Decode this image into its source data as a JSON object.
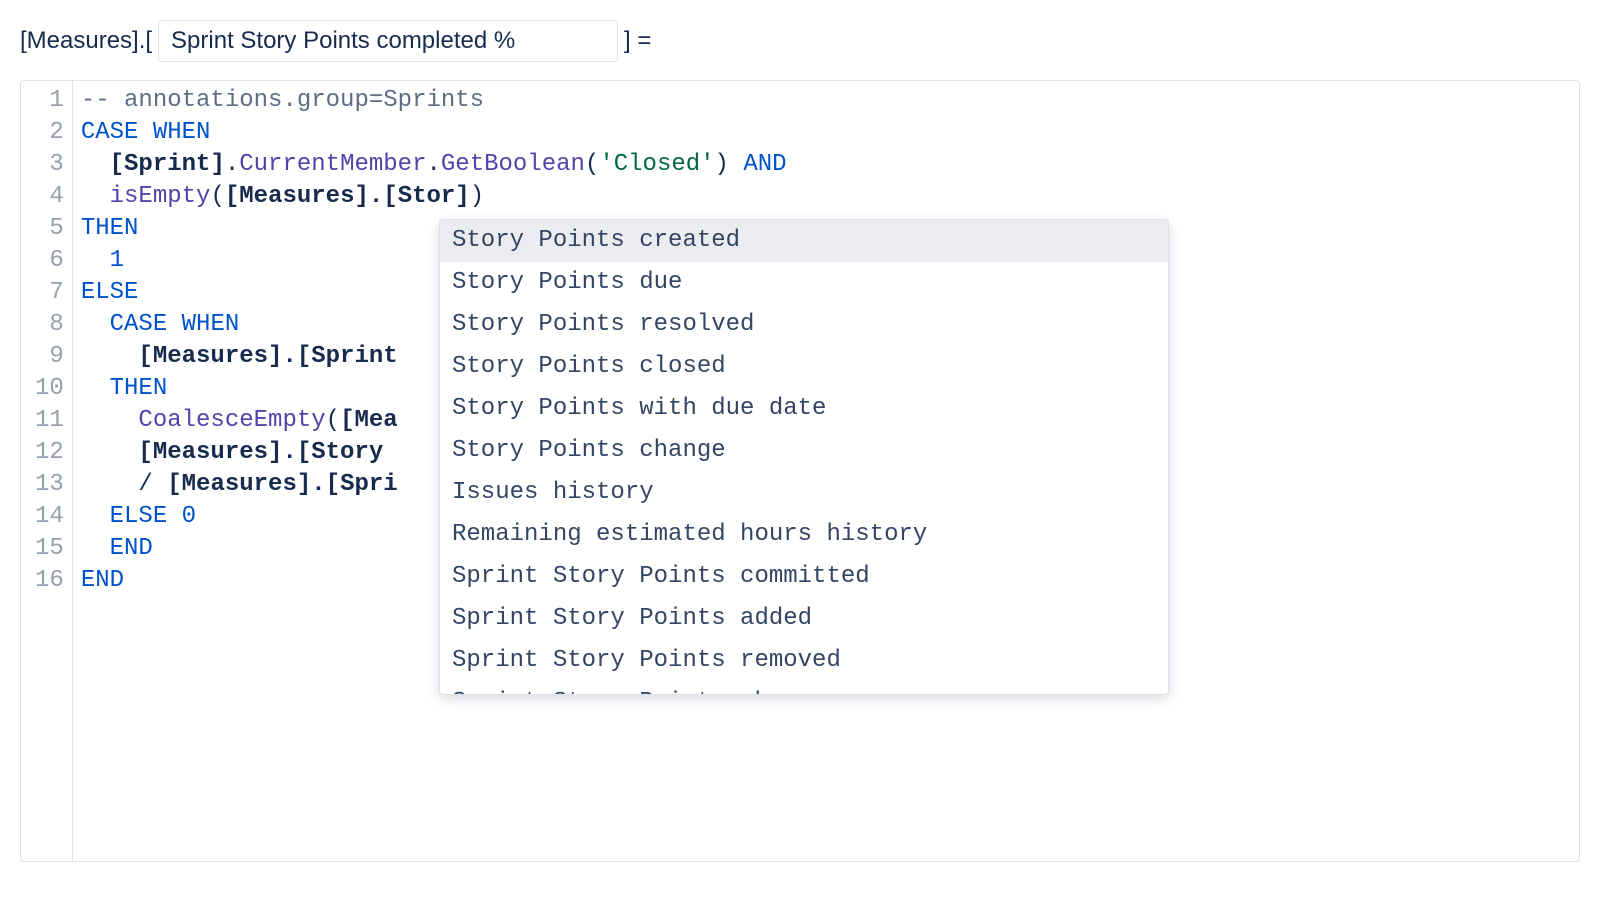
{
  "header": {
    "prefix": "[Measures].[",
    "name_value": "Sprint Story Points completed %",
    "suffix": "] ="
  },
  "code": {
    "lines": [
      {
        "n": 1,
        "tokens": [
          {
            "cls": "tok-comment",
            "t": "-- annotations.group=Sprints"
          }
        ]
      },
      {
        "n": 2,
        "tokens": [
          {
            "cls": "tok-kw",
            "t": "CASE WHEN"
          }
        ]
      },
      {
        "n": 3,
        "tokens": [
          {
            "cls": "",
            "t": "  "
          },
          {
            "cls": "tok-bold",
            "t": "[Sprint]"
          },
          {
            "cls": "",
            "t": "."
          },
          {
            "cls": "tok-purple",
            "t": "CurrentMember"
          },
          {
            "cls": "",
            "t": "."
          },
          {
            "cls": "tok-purple",
            "t": "GetBoolean"
          },
          {
            "cls": "",
            "t": "("
          },
          {
            "cls": "tok-str",
            "t": "'Closed'"
          },
          {
            "cls": "",
            "t": ") "
          },
          {
            "cls": "tok-kw",
            "t": "AND"
          }
        ]
      },
      {
        "n": 4,
        "tokens": [
          {
            "cls": "",
            "t": "  "
          },
          {
            "cls": "tok-purple",
            "t": "isEmpty"
          },
          {
            "cls": "",
            "t": "("
          },
          {
            "cls": "tok-bold",
            "t": "[Measures].[Stor]"
          },
          {
            "cls": "",
            "t": ")"
          }
        ]
      },
      {
        "n": 5,
        "tokens": [
          {
            "cls": "tok-kw",
            "t": "THEN"
          }
        ]
      },
      {
        "n": 6,
        "tokens": [
          {
            "cls": "",
            "t": "  "
          },
          {
            "cls": "tok-num",
            "t": "1"
          }
        ]
      },
      {
        "n": 7,
        "tokens": [
          {
            "cls": "tok-kw",
            "t": "ELSE"
          }
        ]
      },
      {
        "n": 8,
        "tokens": [
          {
            "cls": "",
            "t": "  "
          },
          {
            "cls": "tok-kw",
            "t": "CASE WHEN"
          }
        ]
      },
      {
        "n": 9,
        "tokens": [
          {
            "cls": "",
            "t": "    "
          },
          {
            "cls": "tok-bold",
            "t": "[Measures].[Sprint"
          }
        ]
      },
      {
        "n": 10,
        "tokens": [
          {
            "cls": "",
            "t": "  "
          },
          {
            "cls": "tok-kw",
            "t": "THEN"
          }
        ]
      },
      {
        "n": 11,
        "tokens": [
          {
            "cls": "",
            "t": "    "
          },
          {
            "cls": "tok-purple",
            "t": "CoalesceEmpty"
          },
          {
            "cls": "",
            "t": "("
          },
          {
            "cls": "tok-bold",
            "t": "[Mea"
          }
        ]
      },
      {
        "n": 12,
        "tokens": [
          {
            "cls": "",
            "t": "    "
          },
          {
            "cls": "tok-bold",
            "t": "[Measures].[Story "
          }
        ]
      },
      {
        "n": 13,
        "tokens": [
          {
            "cls": "",
            "t": "    / "
          },
          {
            "cls": "tok-bold",
            "t": "[Measures].[Spri"
          }
        ]
      },
      {
        "n": 14,
        "tokens": [
          {
            "cls": "",
            "t": "  "
          },
          {
            "cls": "tok-kw",
            "t": "ELSE"
          },
          {
            "cls": "",
            "t": " "
          },
          {
            "cls": "tok-num",
            "t": "0"
          }
        ]
      },
      {
        "n": 15,
        "tokens": [
          {
            "cls": "",
            "t": "  "
          },
          {
            "cls": "tok-kw",
            "t": "END"
          }
        ]
      },
      {
        "n": 16,
        "tokens": [
          {
            "cls": "tok-kw",
            "t": "END"
          }
        ]
      }
    ]
  },
  "autocomplete": {
    "selected_index": 0,
    "items": [
      "Story Points created",
      "Story Points due",
      "Story Points resolved",
      "Story Points closed",
      "Story Points with due date",
      "Story Points change",
      "Issues history",
      "Remaining estimated hours history",
      "Sprint Story Points committed",
      "Sprint Story Points added",
      "Sprint Story Points removed",
      "Sprint Story Points change"
    ]
  }
}
